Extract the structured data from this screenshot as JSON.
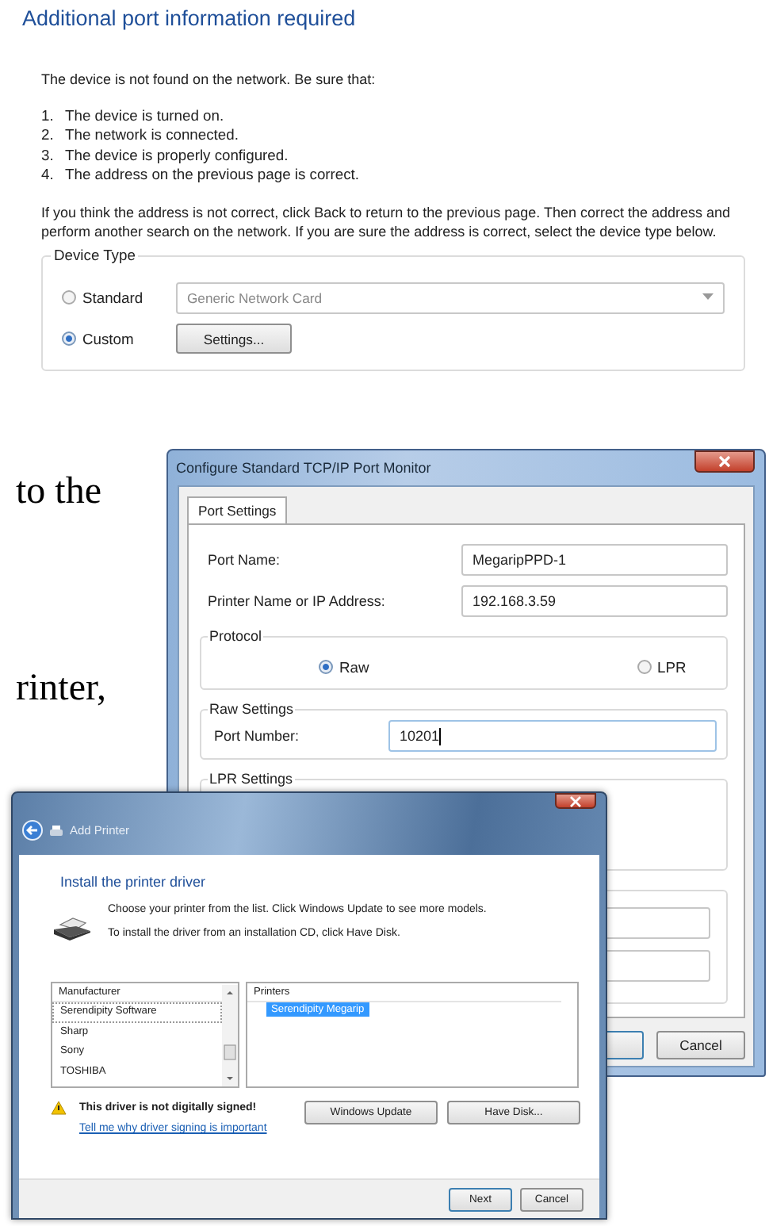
{
  "port_info_panel": {
    "title": "Additional port information required",
    "intro": "The device is not found on the network.  Be sure that:",
    "checklist": [
      {
        "number": "1.",
        "text": "The device is turned on."
      },
      {
        "number": "2.",
        "text": "The network is connected."
      },
      {
        "number": "3.",
        "text": "The device is properly configured."
      },
      {
        "number": "4.",
        "text": "The address on the previous page is correct."
      }
    ],
    "instructions": "If you think the address is not correct, click Back to return to the previous page.  Then correct the address and perform another search on the network.  If you are sure the address is correct, select the device type below.",
    "device_type": {
      "legend": "Device Type",
      "options": [
        {
          "label": "Standard",
          "selected": false,
          "kind": "dropdown",
          "value": "Generic Network Card"
        },
        {
          "label": "Custom",
          "selected": true,
          "kind": "button",
          "button": "Settings..."
        }
      ]
    }
  },
  "document_text": [
    "to the",
    "rinter,"
  ],
  "port_monitor_window": {
    "title": "Configure Standard TCP/IP Port Monitor",
    "tabs": [
      {
        "label": "Port Settings",
        "selected": true
      }
    ],
    "fields": [
      {
        "label": "Port Name:",
        "value": "MegaripPPD-1"
      },
      {
        "label": "Printer Name or IP Address:",
        "value": "192.168.3.59"
      }
    ],
    "protocol": {
      "legend": "Protocol",
      "options": [
        {
          "label": "Raw",
          "selected": true
        },
        {
          "label": "LPR",
          "selected": false
        }
      ]
    },
    "raw_settings": {
      "legend": "Raw Settings",
      "port_number_label": "Port Number:",
      "port_number": "10201"
    },
    "lpr_settings": {
      "legend": "LPR Settings"
    },
    "buttons": [
      "Cancel"
    ]
  },
  "add_printer_window": {
    "title": "Add Printer",
    "heading": "Install the printer driver",
    "lines": [
      "Choose your printer from the list. Click Windows Update to see more models.",
      "To install the driver from an installation CD, click Have Disk."
    ],
    "manufacturer_list": {
      "header": "Manufacturer",
      "items": [
        {
          "label": "Serendipity Software",
          "selected": true
        },
        {
          "label": "Sharp",
          "selected": false
        },
        {
          "label": "Sony",
          "selected": false
        },
        {
          "label": "TOSHIBA",
          "selected": false
        }
      ]
    },
    "printers_list": {
      "header": "Printers",
      "items": [
        {
          "label": "Serendipity Megarip",
          "selected": true
        }
      ]
    },
    "warning": "This driver is not digitally signed!",
    "link": "Tell me why driver signing is important",
    "buttons": [
      "Windows Update",
      "Have Disk..."
    ],
    "footer_buttons": [
      "Next",
      "Cancel"
    ]
  }
}
